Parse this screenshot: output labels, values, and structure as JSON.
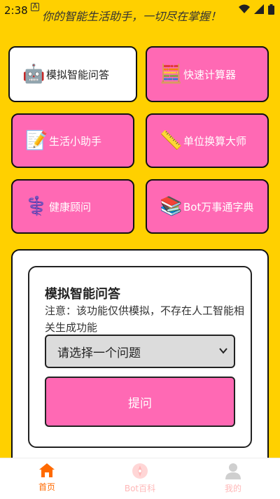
{
  "status_bar": {
    "time": "2:38",
    "notification_badge": "A"
  },
  "header": {
    "tagline": "你的智能生活助手，一切尽在掌握！"
  },
  "tools": [
    {
      "label": "模拟智能问答",
      "icon": "robot-icon",
      "active": true
    },
    {
      "label": "快速计算器",
      "icon": "abacus-icon",
      "active": false
    },
    {
      "label": "生活小助手",
      "icon": "memo-icon",
      "active": false
    },
    {
      "label": "单位换算大师",
      "icon": "ruler-icon",
      "active": false
    },
    {
      "label": "健康顾问",
      "icon": "medical-icon",
      "active": false
    },
    {
      "label": "Bot万事通字典",
      "icon": "books-icon",
      "active": false
    }
  ],
  "qa_card": {
    "title": "模拟智能问答",
    "note": "注意：该功能仅供模拟，不存在人工智能相关生成功能",
    "select_value": "请选择一个问题",
    "ask_label": "提问"
  },
  "bottom_nav": [
    {
      "label": "首页",
      "icon": "home-icon",
      "active": true
    },
    {
      "label": "Bot百科",
      "icon": "compass-icon",
      "active": false
    },
    {
      "label": "我的",
      "icon": "user-icon",
      "active": false
    }
  ],
  "colors": {
    "background": "#FFD000",
    "accent_pink": "#FF69B4",
    "nav_active": "#FF6A00",
    "nav_inactive": "#FFB8B8"
  }
}
